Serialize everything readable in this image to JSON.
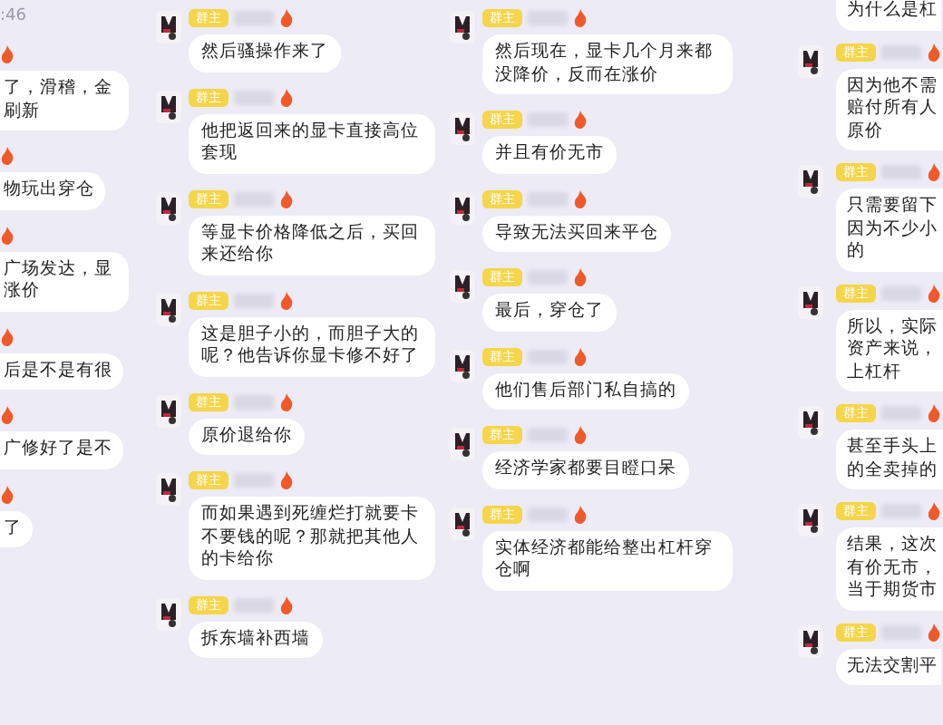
{
  "panels": [
    {
      "kind": "cut-left",
      "time": ":46",
      "messages": [
        {
          "text": "了，滑稽，金刷新"
        },
        {
          "text": "物玩出穿仓"
        },
        {
          "text": "广场发达，显涨价"
        },
        {
          "text": "后是不是有很"
        },
        {
          "text": "广修好了是不"
        },
        {
          "text": "了"
        }
      ]
    },
    {
      "kind": "full",
      "messages": [
        {
          "badge": "群主",
          "text": "然后骚操作来了"
        },
        {
          "badge": "群主",
          "text": "他把返回来的显卡直接高位套现"
        },
        {
          "badge": "群主",
          "text": "等显卡价格降低之后，买回来还给你"
        },
        {
          "badge": "群主",
          "text": "这是胆子小的，而胆子大的呢？他告诉你显卡修不好了"
        },
        {
          "badge": "群主",
          "text": "原价退给你"
        },
        {
          "badge": "群主",
          "text": "而如果遇到死缠烂打就要卡不要钱的呢？那就把其他人的卡给你"
        },
        {
          "badge": "群主",
          "text": "拆东墙补西墙"
        }
      ]
    },
    {
      "kind": "full",
      "messages": [
        {
          "badge": "群主",
          "text": "然后现在，显卡几个月来都没降价，反而在涨价"
        },
        {
          "badge": "群主",
          "text": "并且有价无市"
        },
        {
          "badge": "群主",
          "text": "导致无法买回来平仓"
        },
        {
          "badge": "群主",
          "text": "最后，穿仓了"
        },
        {
          "badge": "群主",
          "text": "他们售后部门私自搞的"
        },
        {
          "badge": "群主",
          "text": "经济学家都要目瞪口呆"
        },
        {
          "badge": "群主",
          "text": "实体经济都能给整出杠杆穿仓啊"
        }
      ]
    },
    {
      "kind": "cut-right",
      "messages": [
        {
          "text": "为什么是杠"
        },
        {
          "badge": "群主",
          "text": "因为他不需赔付所有人原价"
        },
        {
          "badge": "群主",
          "text": "只需要留下因为不少小的"
        },
        {
          "badge": "群主",
          "text": "所以，实际资产来说，上杠杆"
        },
        {
          "badge": "群主",
          "text": "甚至手头上的全卖掉的"
        },
        {
          "badge": "群主",
          "text": "结果，这次有价无市，当于期货市"
        },
        {
          "badge": "群主",
          "text": "无法交割平"
        }
      ]
    }
  ]
}
